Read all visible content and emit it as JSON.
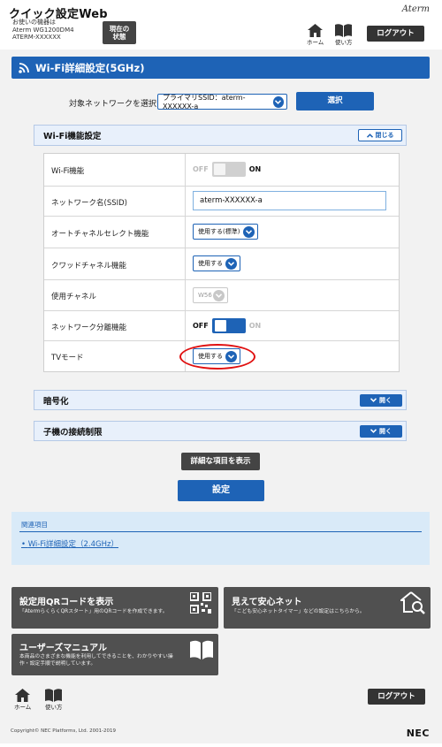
{
  "header": {
    "app_title": "クイック設定Web",
    "device_lines": [
      "お使いの機器は",
      "Aterm WG1200DM4",
      "ATERM-XXXXXX"
    ],
    "status_button": [
      "現在の",
      "状態"
    ],
    "brand": "Aterm",
    "home_label": "ホーム",
    "howto_label": "使い方",
    "logout_label": "ログアウト"
  },
  "page": {
    "title": "Wi-Fi詳細設定(5GHz)",
    "target_network_label": "対象ネットワークを選択",
    "target_network_value": "プライマリSSID：aterm-XXXXXX-a",
    "select_button": "選択"
  },
  "wifi_section": {
    "title": "Wi-Fi機能設定",
    "collapse_label": "閉じる",
    "rows": {
      "wifi_function": {
        "label": "Wi-Fi機能",
        "off": "OFF",
        "on": "ON",
        "state": "on"
      },
      "ssid": {
        "label": "ネットワーク名(SSID)",
        "value": "aterm-XXXXXX-a"
      },
      "auto_channel": {
        "label": "オートチャネルセレクト機能",
        "value": "使用する(標準)"
      },
      "quad_channel": {
        "label": "クワッドチャネル機能",
        "value": "使用する"
      },
      "channel": {
        "label": "使用チャネル",
        "value": "W56"
      },
      "net_separation": {
        "label": "ネットワーク分離機能",
        "off": "OFF",
        "on": "ON",
        "state": "off"
      },
      "tv_mode": {
        "label": "TVモード",
        "value": "使用する"
      }
    }
  },
  "encryption_section": {
    "title": "暗号化",
    "open_label": "開く"
  },
  "child_section": {
    "title": "子機の接続制限",
    "open_label": "開く"
  },
  "buttons": {
    "show_details": "詳細な項目を表示",
    "apply": "設定"
  },
  "related": {
    "title": "関連項目",
    "link": "Wi-Fi詳細設定（2.4GHz）"
  },
  "tiles": {
    "qr": {
      "title": "設定用QRコードを表示",
      "desc": "「AtermらくらくQRスタート」用のQRコードを作成できます。"
    },
    "safety": {
      "title": "見えて安心ネット",
      "desc": "「こども安心ネットタイマー」などの設定はこちらから。"
    },
    "manual": {
      "title": "ユーザーズマニュアル",
      "desc1": "本商品のさまざまな機能を利用してできることを、わかりやすい操",
      "desc2": "作・設定手順で説明しています。"
    }
  },
  "footer": {
    "home_label": "ホーム",
    "howto_label": "使い方",
    "logout_label": "ログアウト",
    "copyright": "Copyright© NEC Platforms, Ltd. 2001-2019",
    "nec": "NEC"
  },
  "colors": {
    "accent": "#1e63b6",
    "highlight": "#e01010"
  }
}
